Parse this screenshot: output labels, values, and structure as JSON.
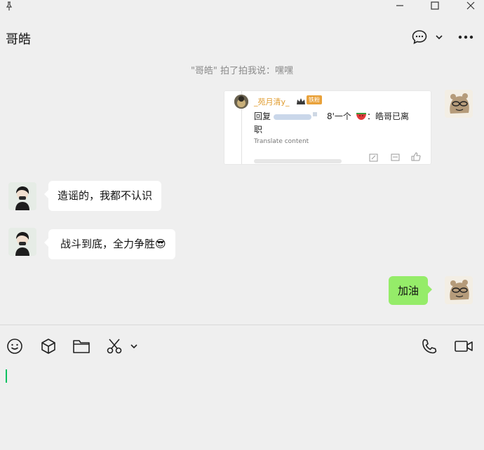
{
  "header": {
    "title": "哥皓"
  },
  "system_message": "\"哥皓\" 拍了拍我说：嘿嘿",
  "quoted_post": {
    "username": "_苑月清y_",
    "badge": "铁粉",
    "line1": "回复",
    "line1_tail": "8'一个",
    "line1_end": "：皓哥已离",
    "line2": "职",
    "translate": "Translate content"
  },
  "messages": [
    {
      "side": "left",
      "text": "造谣的，我都不认识"
    },
    {
      "side": "left",
      "text": "战斗到底，全力争胜",
      "emoji": "😎"
    },
    {
      "side": "right",
      "text": "加油"
    }
  ],
  "colors": {
    "bubble_self": "#95ec69",
    "caret": "#07c160",
    "badge_color": "#e9a23b"
  }
}
